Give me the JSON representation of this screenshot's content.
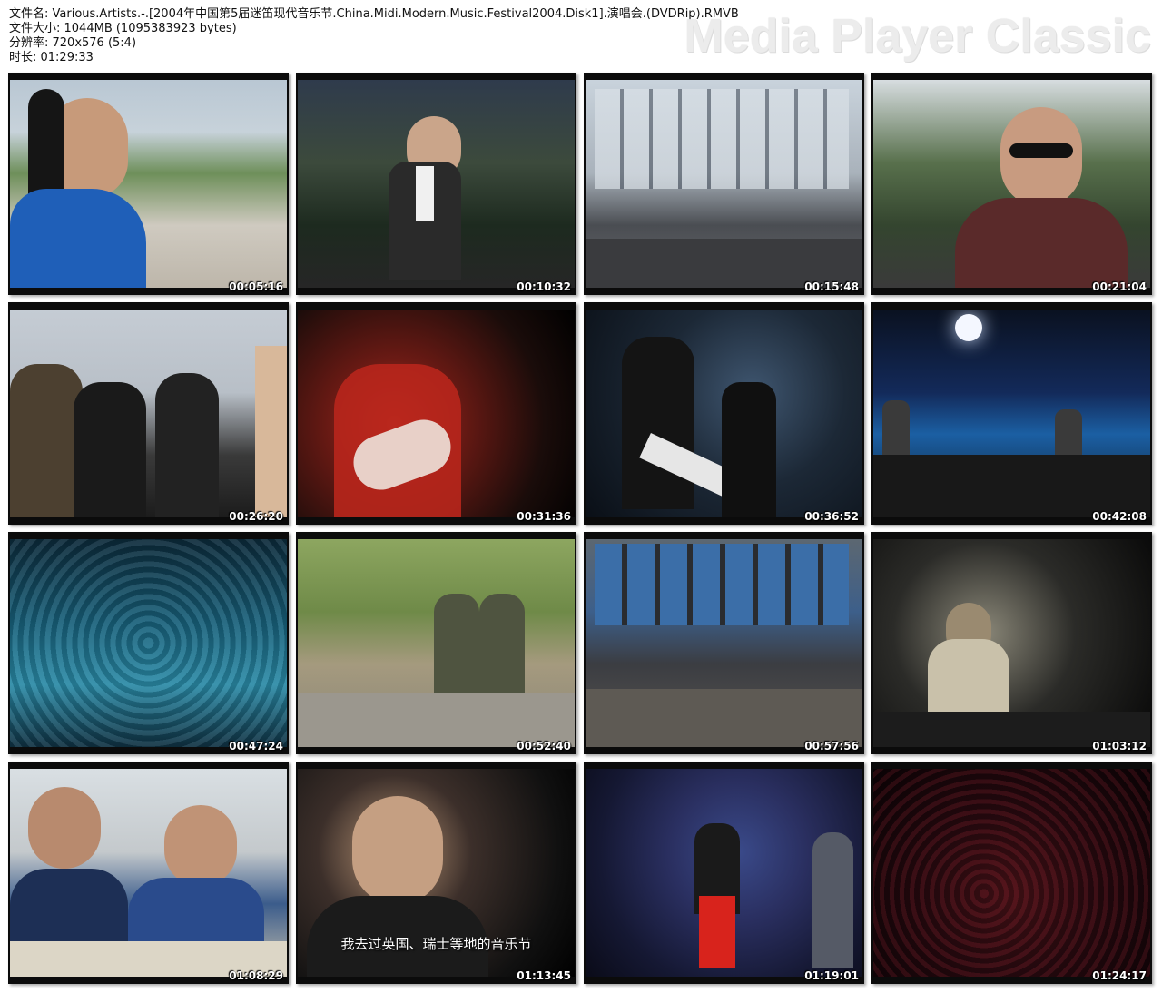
{
  "info": {
    "filename": "文件名: Various.Artists.-.[2004年中国第5届迷笛现代音乐节.China.Midi.Modern.Music.Festival2004.Disk1].演唱会.(DVDRip).RMVB",
    "filesize": "文件大小: 1044MB (1095383923 bytes)",
    "resolution": "分辨率: 720x576 (5:4)",
    "duration": "时长: 01:29:33"
  },
  "watermark": "Media Player Classic",
  "thumbnails": [
    {
      "timestamp": "00:05:16",
      "scene": "s1"
    },
    {
      "timestamp": "00:10:32",
      "scene": "s2"
    },
    {
      "timestamp": "00:15:48",
      "scene": "s3"
    },
    {
      "timestamp": "00:21:04",
      "scene": "s4"
    },
    {
      "timestamp": "00:26:20",
      "scene": "s5"
    },
    {
      "timestamp": "00:31:36",
      "scene": "s6"
    },
    {
      "timestamp": "00:36:52",
      "scene": "s7"
    },
    {
      "timestamp": "00:42:08",
      "scene": "s8"
    },
    {
      "timestamp": "00:47:24",
      "scene": "s9"
    },
    {
      "timestamp": "00:52:40",
      "scene": "s10"
    },
    {
      "timestamp": "00:57:56",
      "scene": "s11"
    },
    {
      "timestamp": "01:03:12",
      "scene": "s12"
    },
    {
      "timestamp": "01:08:29",
      "scene": "s13"
    },
    {
      "timestamp": "01:13:45",
      "scene": "s14",
      "subtitle": "我去过英国、瑞士等地的音乐节"
    },
    {
      "timestamp": "01:19:01",
      "scene": "s15"
    },
    {
      "timestamp": "01:24:17",
      "scene": "s16"
    }
  ]
}
